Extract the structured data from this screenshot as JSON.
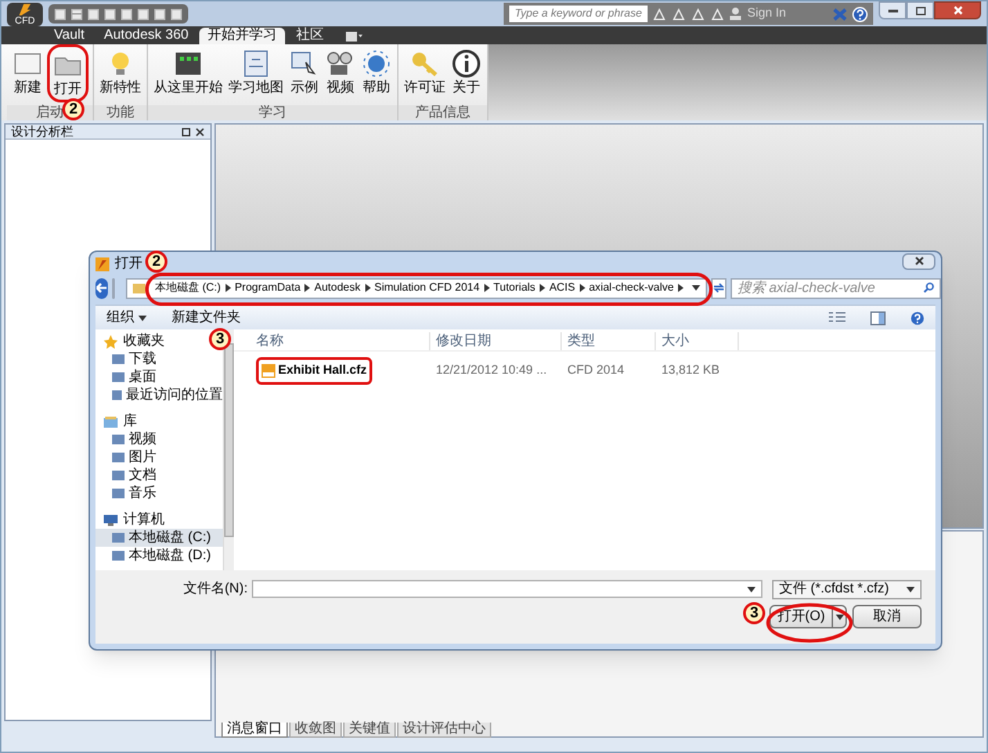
{
  "app": {
    "app_button": "CFD",
    "search": {
      "placeholder": "Type a keyword or phrase"
    },
    "sign_in": "Sign In",
    "tabs": [
      {
        "label": "Vault",
        "selected": false
      },
      {
        "label": "Autodesk 360",
        "selected": false
      },
      {
        "label": "开始并学习",
        "selected": true
      },
      {
        "label": "社区",
        "selected": false
      }
    ],
    "ribbon_groups": [
      {
        "label": "启动",
        "buttons": [
          "新建",
          "打开"
        ]
      },
      {
        "label": "功能",
        "buttons": [
          "新特性"
        ]
      },
      {
        "label": "学习",
        "buttons": [
          "从这里开始",
          "学习地图",
          "示例",
          "视频",
          "帮助"
        ]
      },
      {
        "label": "产品信息",
        "buttons": [
          "许可证",
          "关于"
        ]
      }
    ],
    "left_panel": {
      "title": "设计分析栏"
    },
    "bottom_tabs": [
      {
        "label": "消息窗口",
        "selected": true
      },
      {
        "label": "收敛图",
        "selected": false
      },
      {
        "label": "关键值",
        "selected": false
      },
      {
        "label": "设计评估中心",
        "selected": false
      }
    ]
  },
  "dialog": {
    "title": "打开",
    "breadcrumb": [
      "本地磁盘 (C:)",
      "ProgramData",
      "Autodesk",
      "Simulation CFD 2014",
      "Tutorials",
      "ACIS",
      "axial-check-valve"
    ],
    "search": {
      "placeholder": "搜索 axial-check-valve"
    },
    "toolbar": [
      "组织",
      "新建文件夹"
    ],
    "nav": [
      {
        "label": "收藏夹",
        "children": [
          {
            "label": "下载",
            "selected": false
          },
          {
            "label": "桌面",
            "selected": false
          },
          {
            "label": "最近访问的位置",
            "selected": false
          }
        ]
      },
      {
        "label": "库",
        "children": [
          {
            "label": "视频",
            "selected": false
          },
          {
            "label": "图片",
            "selected": false
          },
          {
            "label": "文档",
            "selected": false
          },
          {
            "label": "音乐",
            "selected": false
          }
        ]
      },
      {
        "label": "计算机",
        "children": [
          {
            "label": "本地磁盘 (C:)",
            "selected": true
          },
          {
            "label": "本地磁盘 (D:)",
            "selected": false
          }
        ]
      }
    ],
    "columns": [
      "名称",
      "修改日期",
      "类型",
      "大小"
    ],
    "rows": [
      [
        "Exhibit Hall.cfz",
        "12/21/2012 10:49 ...",
        "CFD 2014",
        "13,812 KB"
      ]
    ],
    "filename_label": "文件名(N):",
    "filter": "文件 (*.cfdst *.cfz)",
    "open_button": "打开(O)",
    "cancel_button": "取消"
  },
  "annotations": [
    {
      "label": "2"
    },
    {
      "label": "2"
    },
    {
      "label": "3"
    },
    {
      "label": "3"
    }
  ]
}
